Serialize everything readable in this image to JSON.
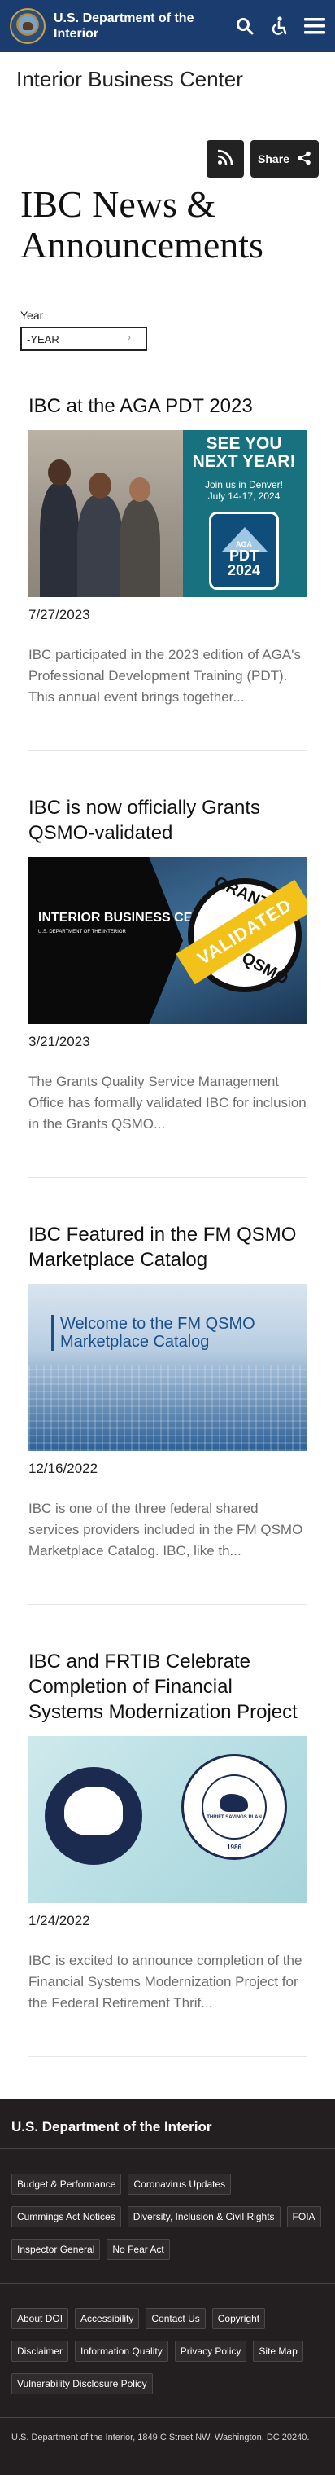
{
  "header": {
    "agency": "U.S. Department of the Interior",
    "icons": [
      "search-icon",
      "accessibility-icon",
      "menu-icon"
    ]
  },
  "subtitle": "Interior Business Center",
  "share": {
    "share_label": "Share"
  },
  "page_title": "IBC News & Announcements",
  "filter": {
    "label": "Year",
    "selected": "-YEAR"
  },
  "news": [
    {
      "title": "IBC at the AGA PDT 2023",
      "date": "7/27/2023",
      "description": "IBC participated in the 2023 edition of AGA's Professional Development Training (PDT). This annual event brings together...",
      "image_text": {
        "headline": "SEE YOU NEXT YEAR!",
        "sub": "Join us in Denver! July 14-17, 2024",
        "badge_org": "AGA",
        "badge_event": "PDT 2024"
      }
    },
    {
      "title": "IBC is now officially Grants QSMO-validated",
      "date": "3/21/2023",
      "description": "The Grants Quality Service Management Office has formally validated IBC for inclusion in the Grants QSMO...",
      "image_text": {
        "org": "INTERIOR BUSINESS CENTER",
        "dept": "U.S. DEPARTMENT OF THE INTERIOR",
        "top": "GRANTS",
        "ribbon": "VALIDATED",
        "bottom": "QSMO"
      }
    },
    {
      "title": "IBC Featured in the FM QSMO Marketplace Catalog",
      "date": "12/16/2022",
      "description": "IBC is one of the three federal shared services providers included in the FM QSMO Marketplace Catalog. IBC, like th...",
      "image_text": {
        "welcome": "Welcome to the FM QSMO Marketplace Catalog"
      }
    },
    {
      "title": "IBC and FRTIB Celebrate Completion of Financial Systems Modernization Project",
      "date": "1/24/2022",
      "description": "IBC is excited to announce completion of the Financial Systems Modernization Project for the Federal Retirement Thrif...",
      "image_text": {
        "seal_name": "THRIFT SAVINGS PLAN",
        "seal_year": "1986"
      }
    }
  ],
  "footer": {
    "title": "U.S. Department of the Interior",
    "links_primary": [
      "Budget & Performance",
      "Coronavirus Updates",
      "Cummings Act Notices",
      "Diversity, Inclusion & Civil Rights",
      "FOIA",
      "Inspector General",
      "No Fear Act"
    ],
    "links_secondary": [
      "About DOI",
      "Accessibility",
      "Contact Us",
      "Copyright",
      "Disclaimer",
      "Information Quality",
      "Privacy Policy",
      "Site Map",
      "Vulnerability Disclosure Policy"
    ],
    "address": "U.S. Department of the Interior, 1849 C Street NW, Washington, DC 20240."
  },
  "colors": {
    "header_bg": "#1b3c6e",
    "footer_bg": "#231f20",
    "button_bg": "#222222"
  }
}
